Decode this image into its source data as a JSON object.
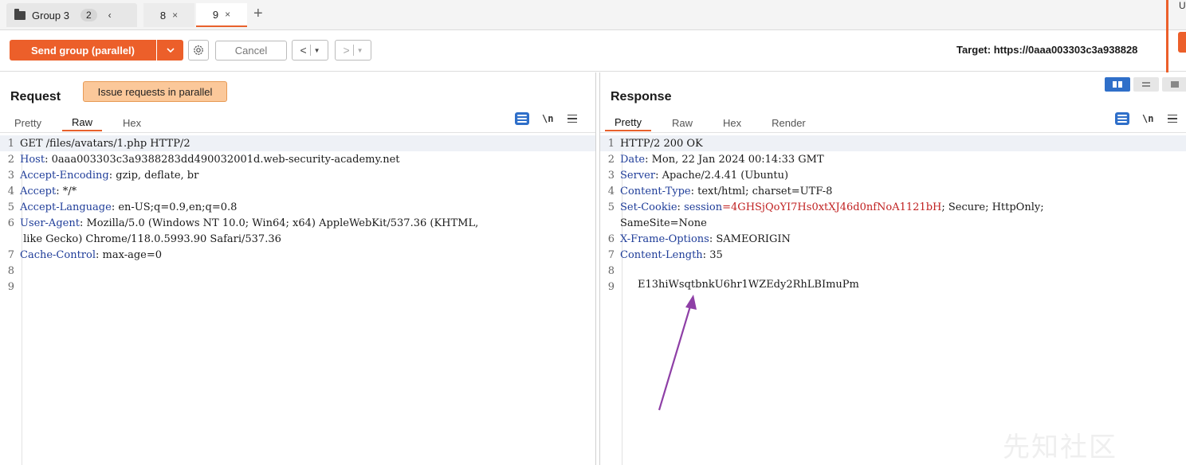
{
  "tabs": {
    "group_label": "Group 3",
    "group_count": "2",
    "group_chevron": "‹",
    "items": [
      {
        "label": "8",
        "close": "×"
      },
      {
        "label": "9",
        "close": "×"
      }
    ],
    "add": "+"
  },
  "toolbar": {
    "send_label": "Send group (parallel)",
    "send_dropdown": "⌄",
    "cancel_label": "Cancel",
    "back_glyph": "<",
    "fwd_glyph": ">",
    "target": "Target: https://0aaa003303c3a938828",
    "side_letter": "U"
  },
  "request": {
    "title": "Request",
    "tooltip": "Issue requests in parallel",
    "tabs": [
      "Pretty",
      "Raw",
      "Hex"
    ],
    "active_tab": "Raw",
    "newline_label": "\\n",
    "lines": [
      {
        "n": "1",
        "key": "",
        "sep": "",
        "value": "GET /files/avatars/1.php HTTP/2"
      },
      {
        "n": "2",
        "key": "Host",
        "sep": ": ",
        "value": "0aaa003303c3a9388283dd490032001d.web-security-academy.net"
      },
      {
        "n": "3",
        "key": "Accept-Encoding",
        "sep": ": ",
        "value": "gzip, deflate, br"
      },
      {
        "n": "4",
        "key": "Accept",
        "sep": ": ",
        "value": "*/*"
      },
      {
        "n": "5",
        "key": "Accept-Language",
        "sep": ": ",
        "value": "en-US;q=0.9,en;q=0.8"
      },
      {
        "n": "6",
        "key": "User-Agent",
        "sep": ": ",
        "value": "Mozilla/5.0 (Windows NT 10.0; Win64; x64) AppleWebKit/537.36 (KHTML,"
      },
      {
        "n": "",
        "key": "",
        "sep": "",
        "value": " like Gecko) Chrome/118.0.5993.90 Safari/537.36"
      },
      {
        "n": "7",
        "key": "Cache-Control",
        "sep": ": ",
        "value": "max-age=0"
      },
      {
        "n": "8",
        "key": "",
        "sep": "",
        "value": ""
      },
      {
        "n": "9",
        "key": "",
        "sep": "",
        "value": ""
      }
    ]
  },
  "response": {
    "title": "Response",
    "tabs": [
      "Pretty",
      "Raw",
      "Hex",
      "Render"
    ],
    "active_tab": "Pretty",
    "newline_label": "\\n",
    "lines": [
      {
        "n": "1",
        "key": "",
        "sep": "",
        "value": "HTTP/2 200 OK"
      },
      {
        "n": "2",
        "key": "Date",
        "sep": ": ",
        "value": "Mon, 22 Jan 2024 00:14:33 GMT"
      },
      {
        "n": "3",
        "key": "Server",
        "sep": ": ",
        "value": "Apache/2.4.41 (Ubuntu)"
      },
      {
        "n": "4",
        "key": "Content-Type",
        "sep": ": ",
        "value": "text/html; charset=UTF-8"
      },
      {
        "n": "5",
        "key": "Set-Cookie",
        "sep": ": ",
        "value": ""
      },
      {
        "n": "",
        "key": "",
        "sep": "",
        "value": "SameSite=None"
      },
      {
        "n": "6",
        "key": "X-Frame-Options",
        "sep": ": ",
        "value": "SAMEORIGIN"
      },
      {
        "n": "7",
        "key": "Content-Length",
        "sep": ": ",
        "value": "35"
      },
      {
        "n": "8",
        "key": "",
        "sep": "",
        "value": ""
      },
      {
        "n": "9",
        "key": "",
        "sep": "",
        "value": ""
      }
    ],
    "cookie_name": "session",
    "cookie_eq": "=",
    "cookie_value": "4GHSjQoYI7Hs0xtXJ46d0nfNoA1121bH",
    "cookie_rest": "; Secure; HttpOnly;",
    "body": "E13hiWsqtbnkU6hr1WZEdy2RhLBImuPm"
  },
  "watermark": "先知社区",
  "colors": {
    "accent": "#ec5f2a",
    "header_key": "#1f3d99",
    "cookie_value": "#c02121",
    "arrow": "#8e3fa6"
  }
}
